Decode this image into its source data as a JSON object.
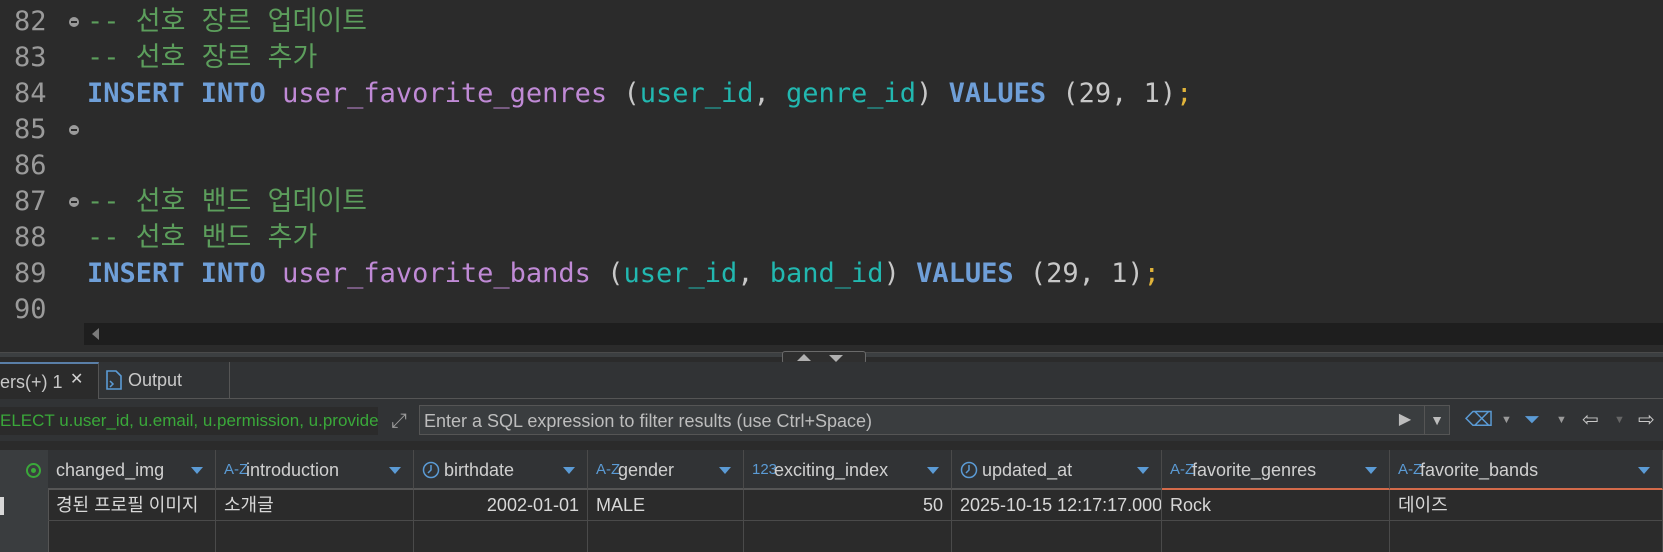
{
  "editor": {
    "lines": [
      {
        "n": "82",
        "fold": true,
        "parts": [
          {
            "t": "-- 선호 장르 업데이트",
            "c": "cm"
          }
        ]
      },
      {
        "n": "83",
        "fold": false,
        "parts": [
          {
            "t": "-- 선호 장르 추가",
            "c": "cm"
          }
        ]
      },
      {
        "n": "84",
        "fold": false,
        "parts": [
          {
            "t": "INSERT INTO",
            "c": "kw"
          },
          {
            "t": " ",
            "c": "pn"
          },
          {
            "t": "user_favorite_genres",
            "c": "tbl"
          },
          {
            "t": " (",
            "c": "pn"
          },
          {
            "t": "user_id",
            "c": "col"
          },
          {
            "t": ", ",
            "c": "pn"
          },
          {
            "t": "genre_id",
            "c": "col"
          },
          {
            "t": ") ",
            "c": "pn"
          },
          {
            "t": "VALUES",
            "c": "kw"
          },
          {
            "t": " (29, 1)",
            "c": "num"
          },
          {
            "t": ";",
            "c": "semi"
          }
        ]
      },
      {
        "n": "85",
        "fold": true,
        "parts": []
      },
      {
        "n": "86",
        "fold": false,
        "parts": []
      },
      {
        "n": "87",
        "fold": true,
        "parts": [
          {
            "t": "-- 선호 밴드 업데이트",
            "c": "cm"
          }
        ]
      },
      {
        "n": "88",
        "fold": false,
        "parts": [
          {
            "t": "-- 선호 밴드 추가",
            "c": "cm"
          }
        ]
      },
      {
        "n": "89",
        "fold": false,
        "parts": [
          {
            "t": "INSERT INTO",
            "c": "kw"
          },
          {
            "t": " ",
            "c": "pn"
          },
          {
            "t": "user_favorite_bands",
            "c": "tbl"
          },
          {
            "t": " (",
            "c": "pn"
          },
          {
            "t": "user_id",
            "c": "col"
          },
          {
            "t": ", ",
            "c": "pn"
          },
          {
            "t": "band_id",
            "c": "col"
          },
          {
            "t": ") ",
            "c": "pn"
          },
          {
            "t": "VALUES",
            "c": "kw"
          },
          {
            "t": " (29, 1)",
            "c": "num"
          },
          {
            "t": ";",
            "c": "semi"
          }
        ]
      },
      {
        "n": "90",
        "fold": false,
        "parts": []
      }
    ]
  },
  "tabs": {
    "result_label": "ers(+) 1",
    "close_glyph": "✕",
    "output_label": "Output"
  },
  "filter": {
    "sql_text": "ELECT u.user_id, u.email, u.permission, u.provider",
    "placeholder": "Enter a SQL expression to filter results (use Ctrl+Space)"
  },
  "grid": {
    "columns": [
      {
        "label": "changed_img",
        "type_icon": "",
        "modified": false
      },
      {
        "label": "introduction",
        "type_icon": "A-Z",
        "modified": false
      },
      {
        "label": "birthdate",
        "type_icon": "clock",
        "modified": false
      },
      {
        "label": "gender",
        "type_icon": "A-Z",
        "modified": false
      },
      {
        "label": "exciting_index",
        "type_icon": "123",
        "modified": false
      },
      {
        "label": "updated_at",
        "type_icon": "clock",
        "modified": false
      },
      {
        "label": "favorite_genres",
        "type_icon": "A-Z",
        "modified": true
      },
      {
        "label": "favorite_bands",
        "type_icon": "A-Z",
        "modified": true
      }
    ],
    "row": [
      "경된 프로필 이미지",
      "소개글",
      "2002-01-01",
      "MALE",
      "50",
      "2025-10-15 12:17:17.000",
      "Rock",
      "데이즈"
    ]
  },
  "colors": {
    "comment": "#5c9e5c",
    "keyword": "#6f9fd8",
    "table": "#c08ad6",
    "column": "#22b8b0",
    "semicolon": "#e0b33a",
    "sql_preview": "#3aa83a"
  },
  "icons": {
    "expand": "expand-icon",
    "run": "play-icon",
    "eraser": "eraser-icon",
    "funnel": "funnel-icon",
    "back": "back-arrow-icon",
    "forward": "forward-arrow-icon"
  }
}
